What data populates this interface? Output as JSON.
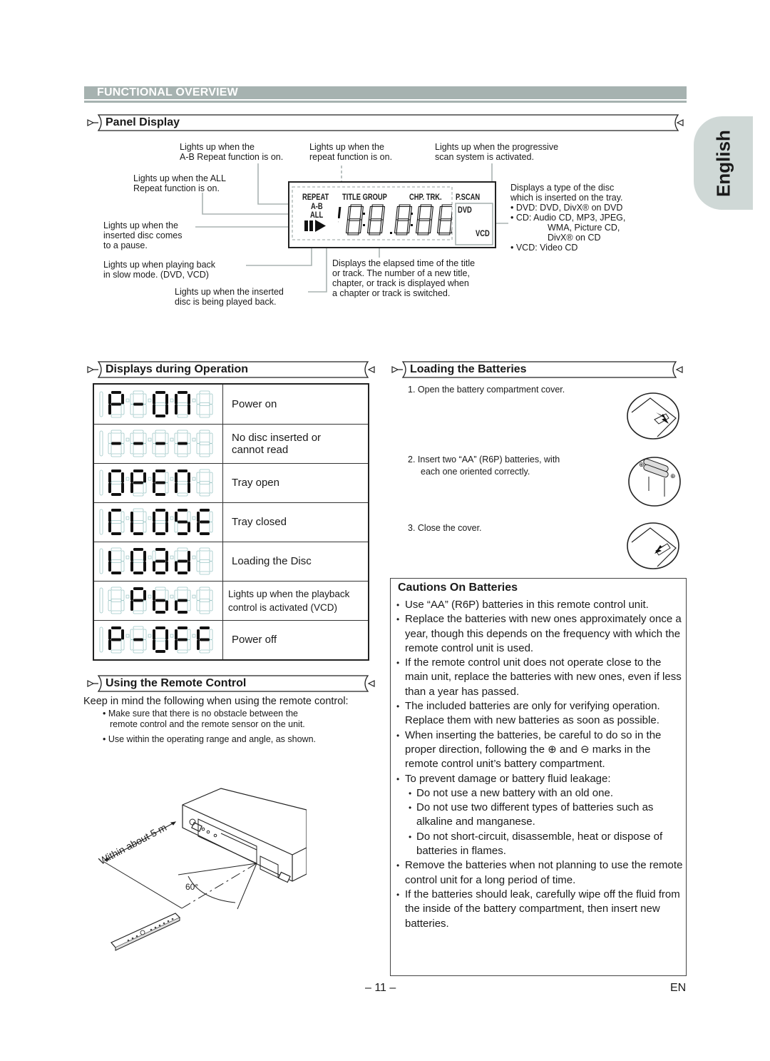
{
  "section_title": "FUNCTIONAL OVERVIEW",
  "language_tab": "English",
  "panel_display": {
    "heading": "Panel Display",
    "lcd": {
      "labels": {
        "repeat": "REPEAT",
        "title_group": "TITLE GROUP",
        "chp_trk": "CHP. TRK.",
        "pscan": "P.SCAN",
        "ab": "A-B",
        "all": "ALL",
        "dvd": "DVD",
        "vcd": "VCD"
      },
      "digits": "18:88:88"
    },
    "callouts": {
      "ab_repeat": [
        "Lights up when the",
        "A-B Repeat function is on."
      ],
      "repeat": [
        "Lights up when the",
        "repeat function is on."
      ],
      "pscan": [
        "Lights up when the progressive",
        "scan system is activated."
      ],
      "all_repeat": [
        "Lights up when the ALL",
        "Repeat function is on."
      ],
      "pause": [
        "Lights up when the",
        "inserted disc comes",
        "to a pause."
      ],
      "slow": [
        "Lights up when playing back",
        "in slow mode. (DVD, VCD)"
      ],
      "play": [
        "Lights up when the inserted",
        "disc is being played back."
      ],
      "elapsed": [
        "Displays the elapsed time of the title",
        "or track. The number of a new title,",
        "chapter, or track is displayed when",
        "a chapter or track is switched."
      ],
      "disc_type": {
        "intro": [
          "Displays a type of the disc",
          "which is inserted on the tray."
        ],
        "items": [
          "• DVD: DVD, DivX® on DVD",
          "• CD: Audio CD, MP3, JPEG,",
          "WMA, Picture CD,",
          "DivX® on CD",
          "• VCD: Video CD"
        ]
      }
    }
  },
  "displays_during_operation": {
    "heading": "Displays during Operation",
    "rows": [
      {
        "display": "P-On",
        "chars": [
          "P",
          "-",
          "o",
          "n",
          ""
        ],
        "desc": [
          "Power on"
        ]
      },
      {
        "display": "----",
        "chars": [
          "-",
          "-",
          "-",
          "-",
          ""
        ],
        "desc": [
          "No disc inserted or",
          "cannot read"
        ]
      },
      {
        "display": "OPEn",
        "chars": [
          "o",
          "P",
          "E",
          "n",
          ""
        ],
        "desc": [
          "Tray open"
        ]
      },
      {
        "display": "CLoSE",
        "chars": [
          "C",
          "L",
          "o",
          "S",
          "E"
        ],
        "desc": [
          "Tray closed"
        ]
      },
      {
        "display": "Load",
        "chars": [
          "L",
          "o",
          "a",
          "d",
          ""
        ],
        "desc": [
          "Loading the Disc"
        ]
      },
      {
        "display": "Pbc",
        "chars": [
          "",
          "P",
          "b",
          "c",
          ""
        ],
        "desc": [
          "Lights up when the playback",
          "control is activated (VCD)"
        ]
      },
      {
        "display": "P-OFF",
        "chars": [
          "P",
          "-",
          "o",
          "F",
          "F"
        ],
        "desc": [
          "Power off"
        ]
      }
    ]
  },
  "remote_control": {
    "heading": "Using the Remote Control",
    "intro": "Keep in mind the following when using the remote control:",
    "bullets": [
      [
        "• Make sure that there is no obstacle between the",
        "remote control and the remote sensor on the unit."
      ],
      [
        "• Use within the operating range and angle, as shown."
      ]
    ],
    "diagram": {
      "distance_label": "Within about 5 m",
      "angle_label": "60°"
    }
  },
  "loading_batteries": {
    "heading": "Loading the Batteries",
    "steps": [
      [
        "1. Open the battery compartment cover."
      ],
      [
        "2. Insert two “AA” (R6P) batteries, with",
        "each one oriented correctly."
      ],
      [
        "3. Close the cover."
      ]
    ]
  },
  "cautions": {
    "title": "Cautions On Batteries",
    "bullets": [
      {
        "level": 1,
        "text": "Use “AA” (R6P) batteries in this remote control unit."
      },
      {
        "level": 1,
        "text": "Replace the batteries with new ones approximately once a year, though this depends on the frequency with which the remote control unit is used."
      },
      {
        "level": 1,
        "text": "If the remote control unit does not operate close to the main unit, replace the batteries with new ones, even if less than a year has passed."
      },
      {
        "level": 1,
        "text": "The included batteries are only for verifying operation. Replace them with new batteries as soon as possible."
      },
      {
        "level": 1,
        "text": "When inserting the batteries, be careful to do so in the proper direction, following the ⊕ and ⊖ marks in the remote control unit’s battery compartment."
      },
      {
        "level": 1,
        "text": "To prevent damage or battery fluid leakage:"
      },
      {
        "level": 2,
        "text": "Do not use a new battery with an old one."
      },
      {
        "level": 2,
        "text": "Do not use two different types of batteries such as alkaline and manganese."
      },
      {
        "level": 2,
        "text": "Do not short-circuit, disassemble, heat or dispose of batteries in flames."
      },
      {
        "level": 1,
        "text": "Remove the batteries when not planning to use the remote control unit for a long period of time."
      },
      {
        "level": 1,
        "text": "If the batteries should leak, carefully wipe off the fluid from the inside of the battery compartment, then insert new batteries."
      }
    ]
  },
  "footer": {
    "page_number": "– 11 –",
    "lang_code": "EN"
  }
}
